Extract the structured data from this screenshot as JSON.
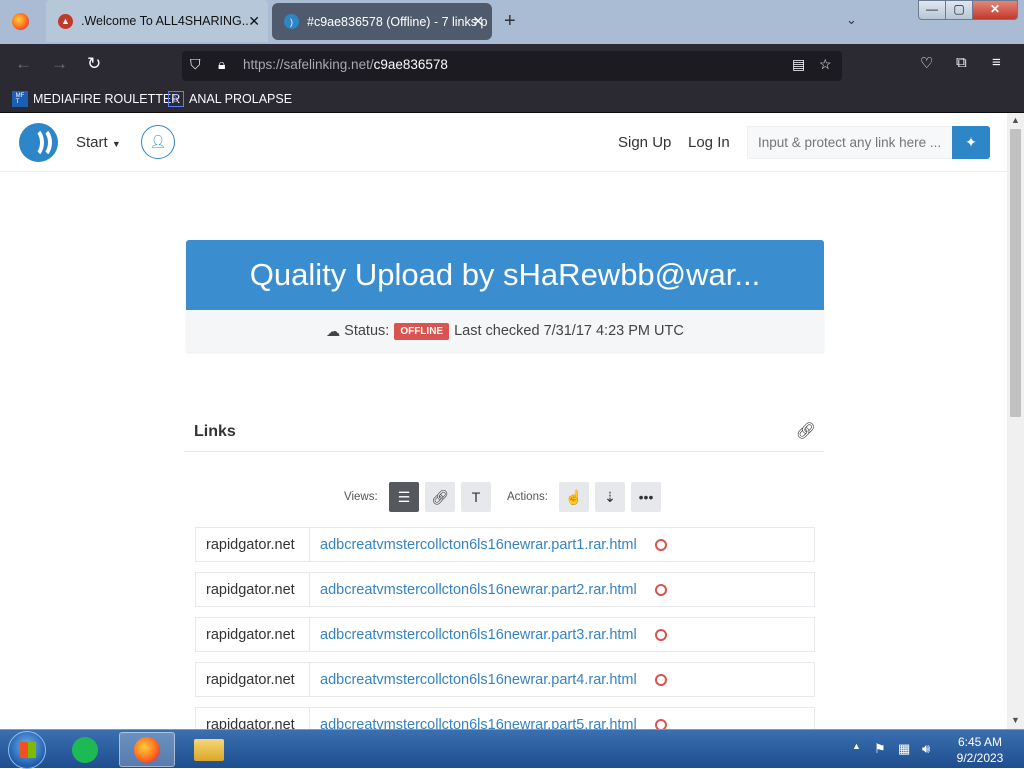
{
  "browser": {
    "tabs": [
      {
        "title": ".Welcome To ALL4SHARING..",
        "close": "✕"
      },
      {
        "title": "#c9ae836578 (Offline) - 7 links p",
        "close": "✕"
      }
    ],
    "new_tab": "+",
    "tab_list": "⌄",
    "window_controls": {
      "minimize": "—",
      "maximize": "▢",
      "close": "✕"
    },
    "url": {
      "base": "https://safelinking.net/",
      "path": "c9ae836578"
    },
    "bookmarks": [
      {
        "label": "MEDIAFIRE ROULETTER",
        "icon": "mediafire-icon"
      },
      {
        "label": "ANAL PROLAPSE",
        "icon": "bookmark-icon"
      }
    ]
  },
  "site": {
    "start_label": "Start",
    "sign_up": "Sign Up",
    "log_in": "Log In",
    "protect_placeholder": "Input & protect any link here ...",
    "accent_color": "#2d86c8"
  },
  "package": {
    "title": "Quality Upload by sHaRewbb@war...",
    "status_label": "Status:",
    "status_badge": "OFFLINE",
    "last_checked": "Last checked 7/31/17 4:23 PM UTC"
  },
  "links": {
    "header": "Links",
    "views_label": "Views:",
    "actions_label": "Actions:",
    "rows": [
      {
        "host": "rapidgator.net",
        "file": "adbcreatvmstercollcton6ls16newrar.part1.rar.html"
      },
      {
        "host": "rapidgator.net",
        "file": "adbcreatvmstercollcton6ls16newrar.part2.rar.html"
      },
      {
        "host": "rapidgator.net",
        "file": "adbcreatvmstercollcton6ls16newrar.part3.rar.html"
      },
      {
        "host": "rapidgator.net",
        "file": "adbcreatvmstercollcton6ls16newrar.part4.rar.html"
      },
      {
        "host": "rapidgator.net",
        "file": "adbcreatvmstercollcton6ls16newrar.part5.rar.html"
      }
    ]
  },
  "taskbar": {
    "time": "6:45 AM",
    "date": "9/2/2023"
  }
}
